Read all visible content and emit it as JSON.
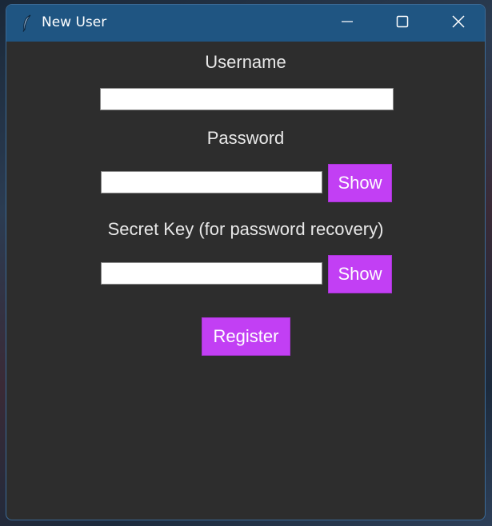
{
  "window": {
    "title": "New User",
    "app_icon": "feather-icon",
    "controls": {
      "minimize_icon": "minimize-icon",
      "maximize_icon": "maximize-icon",
      "close_icon": "close-icon"
    }
  },
  "form": {
    "username_label": "Username",
    "username_value": "",
    "password_label": "Password",
    "password_value": "",
    "password_show_label": "Show",
    "secret_key_label": "Secret Key (for password recovery)",
    "secret_key_value": "",
    "secret_key_show_label": "Show",
    "register_label": "Register"
  },
  "colors": {
    "titlebar": "#1f5582",
    "window_background": "#2d2d2d",
    "button_accent": "#c23ff4",
    "label_text": "#e8e8e8"
  }
}
